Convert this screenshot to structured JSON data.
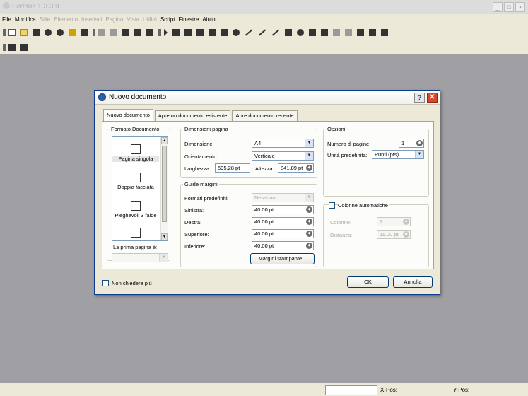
{
  "app": {
    "title": "Scribus 1.3.3.9"
  },
  "menubar": [
    {
      "label": "File",
      "disabled": false
    },
    {
      "label": "Modifica",
      "disabled": false
    },
    {
      "label": "Stile",
      "disabled": true
    },
    {
      "label": "Elemento",
      "disabled": true
    },
    {
      "label": "Inserisci",
      "disabled": true
    },
    {
      "label": "Pagina",
      "disabled": true
    },
    {
      "label": "Vista",
      "disabled": true
    },
    {
      "label": "Utilità",
      "disabled": true
    },
    {
      "label": "Script",
      "disabled": false
    },
    {
      "label": "Finestre",
      "disabled": false
    },
    {
      "label": "Aiuto",
      "disabled": false
    }
  ],
  "statusbar": {
    "x_label": "X-Pos:",
    "y_label": "Y-Pos:"
  },
  "dialog": {
    "title": "Nuovo documento",
    "help_glyph": "?",
    "close_glyph": "✕",
    "tabs": [
      "Nuovo documento",
      "Apre un documento esistente",
      "Apre documento recente"
    ],
    "formato": {
      "legend": "Formato Documento",
      "items": [
        "Pagina singola",
        "Doppia facciata",
        "Pieghevoli 3 falde"
      ],
      "first_page_label": "La prima pagina è:"
    },
    "dimensioni": {
      "legend": "Dimensioni pagina",
      "size_label": "Dimensione:",
      "size_value": "A4",
      "orientation_label": "Orientamento:",
      "orientation_value": "Verticale",
      "width_label": "Larghezza:",
      "width_value": "595.28 pt",
      "height_label": "Altezza:",
      "height_value": "841.89 pt"
    },
    "margini": {
      "legend": "Guide margini",
      "preset_label": "Formati predefiniti:",
      "preset_value": "Nessuno",
      "left_label": "Sinistra:",
      "left_value": "40.00 pt",
      "right_label": "Destra:",
      "right_value": "40.00 pt",
      "top_label": "Superiore:",
      "top_value": "40.00 pt",
      "bottom_label": "Inferiore:",
      "bottom_value": "40.00 pt",
      "printer_button": "Margini stampante..."
    },
    "opzioni": {
      "legend": "Opzioni",
      "pages_label": "Numero di pagine:",
      "pages_value": "1",
      "unit_label": "Unità predefinita:",
      "unit_value": "Punti (pts)"
    },
    "colonne": {
      "legend": "Colonne automatiche",
      "columns_label": "Colonne:",
      "columns_value": "1",
      "gap_label": "Distanza:",
      "gap_value": "11.00 pt"
    },
    "dont_ask_label": "Non chiedere più",
    "ok_label": "OK",
    "cancel_label": "Annulla"
  }
}
